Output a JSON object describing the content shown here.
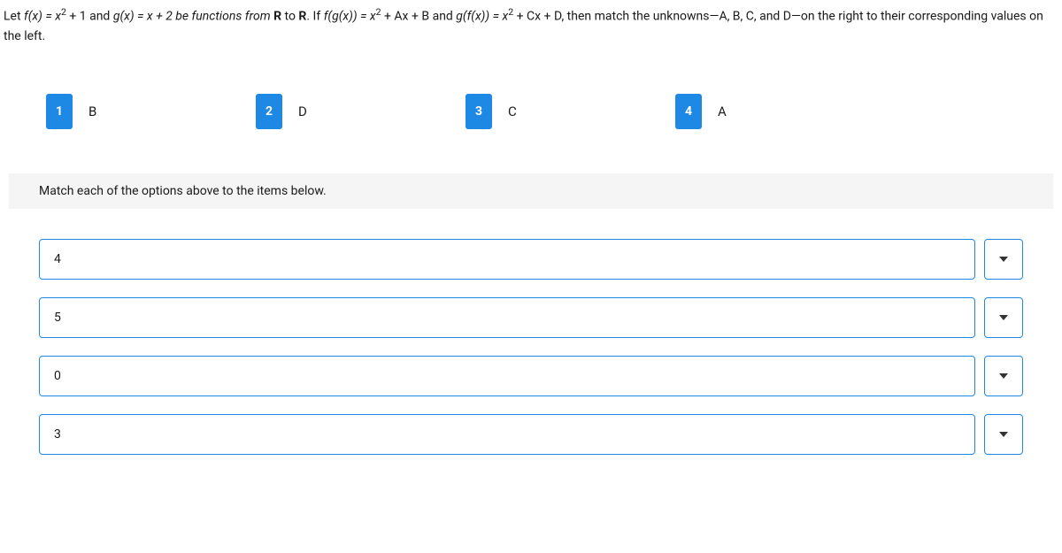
{
  "question": {
    "prefix": "Let ",
    "fx": "f(x) = x",
    "fx_after": " + 1 and ",
    "gx": "g(x) = x + 2 be functions from ",
    "r1": "R",
    "to": " to ",
    "r2": "R",
    "dot": ". If  ",
    "fgx": "f(g(x)) = x",
    "fgx_after": " + Ax + B and  ",
    "gfx": "g(f(x)) = x",
    "gfx_after": " + Cx + D, then match the unknowns—A, B, C, and D—on the right to their corresponding values on the left."
  },
  "options": [
    {
      "num": "1",
      "letter": "B"
    },
    {
      "num": "2",
      "letter": "D"
    },
    {
      "num": "3",
      "letter": "C"
    },
    {
      "num": "4",
      "letter": "A"
    }
  ],
  "instruction": "Match each of the options above to the items below.",
  "items": [
    "4",
    "5",
    "0",
    "3"
  ]
}
